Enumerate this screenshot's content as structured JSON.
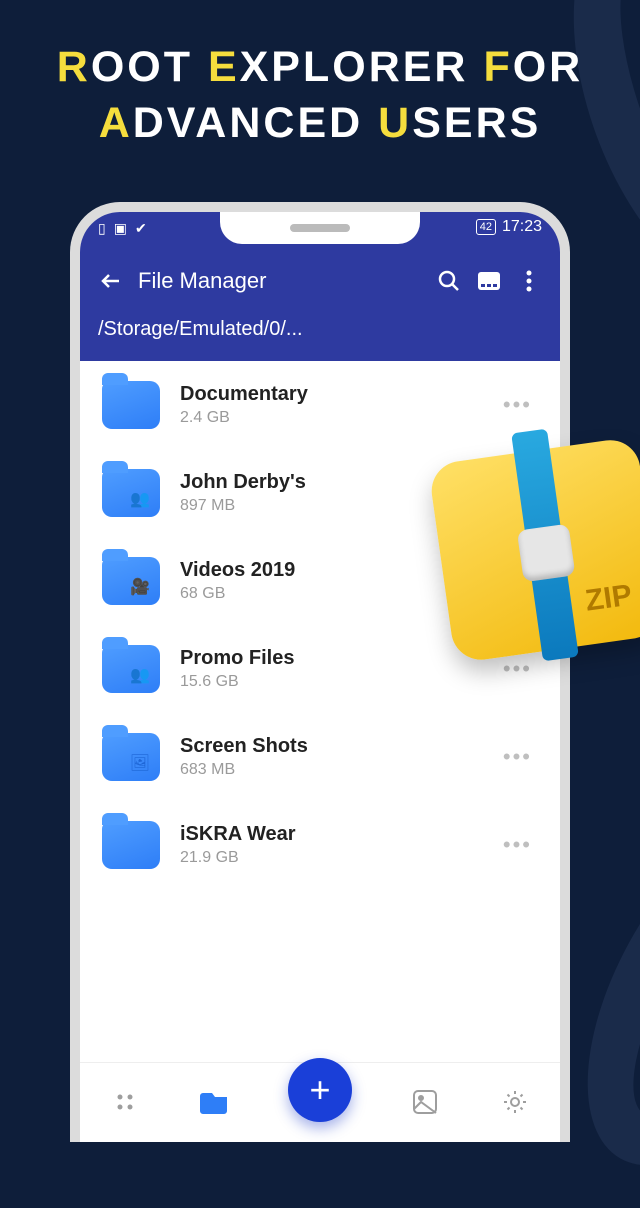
{
  "promo": {
    "line1": {
      "h1": "R",
      "t1": "OOT ",
      "h2": "E",
      "t2": "XPLORER ",
      "h3": "F",
      "t3": "OR"
    },
    "line2": {
      "h1": "A",
      "t1": "DVANCED ",
      "h2": "U",
      "t2": "SERS"
    }
  },
  "status": {
    "battery": "42",
    "time": "17:23"
  },
  "header": {
    "title": "File Manager",
    "path": "/Storage/Emulated/0/..."
  },
  "files": [
    {
      "name": "Documentary",
      "size": "2.4 GB",
      "glyph": ""
    },
    {
      "name": "John Derby's",
      "size": "897 MB",
      "glyph": "👥"
    },
    {
      "name": "Videos 2019",
      "size": "68 GB",
      "glyph": "🎥"
    },
    {
      "name": "Promo Files",
      "size": "15.6 GB",
      "glyph": "👥"
    },
    {
      "name": "Screen Shots",
      "size": "683 MB",
      "glyph": "🖼"
    },
    {
      "name": "iSKRA Wear",
      "size": "21.9 GB",
      "glyph": ""
    }
  ],
  "overlay": {
    "zip_label": "ZIP"
  },
  "fab": {
    "label": "+"
  }
}
